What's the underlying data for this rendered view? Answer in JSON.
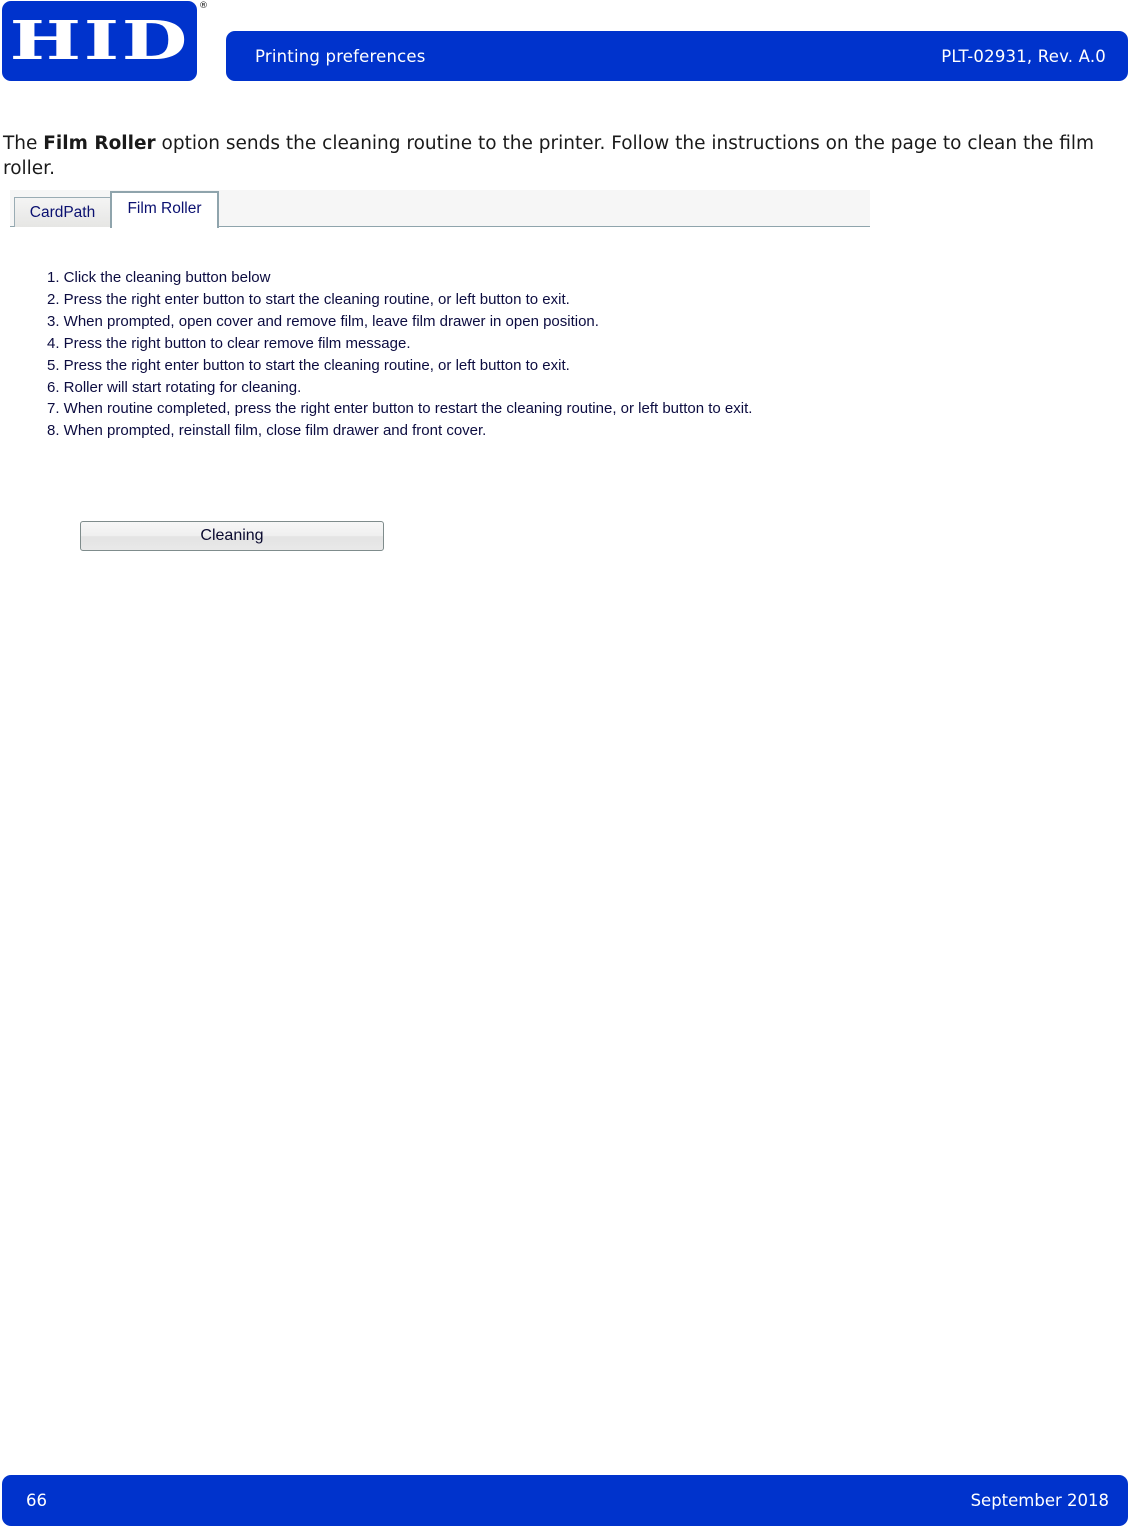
{
  "brand": {
    "logo_text": "HID",
    "registered_mark": "®",
    "color": "#0033cc"
  },
  "header": {
    "section_title": "Printing preferences",
    "doc_id": "PLT-02931, Rev. A.0"
  },
  "intro": {
    "prefix": "The ",
    "bold_term": "Film Roller",
    "suffix": " option sends the cleaning routine to the printer. Follow the instructions on the page to clean the film roller."
  },
  "dialog": {
    "tabs": [
      {
        "label": "CardPath",
        "selected": false
      },
      {
        "label": "Film Roller",
        "selected": true
      }
    ],
    "steps": [
      "1. Click the cleaning button below",
      "2. Press the right enter button to start the cleaning routine, or left button to exit.",
      "3. When prompted, open cover and remove film, leave film drawer in open position.",
      "4. Press the right button to clear remove film message.",
      "5. Press the right enter button to start the cleaning routine, or left button to exit.",
      "6. Roller will start rotating for cleaning.",
      "7. When routine completed, press the right enter button to restart the cleaning routine, or left button to exit.",
      "8. When prompted, reinstall film, close film drawer and front cover."
    ],
    "cleaning_button_label": "Cleaning"
  },
  "footer": {
    "page_number": "66",
    "date": "September 2018"
  }
}
